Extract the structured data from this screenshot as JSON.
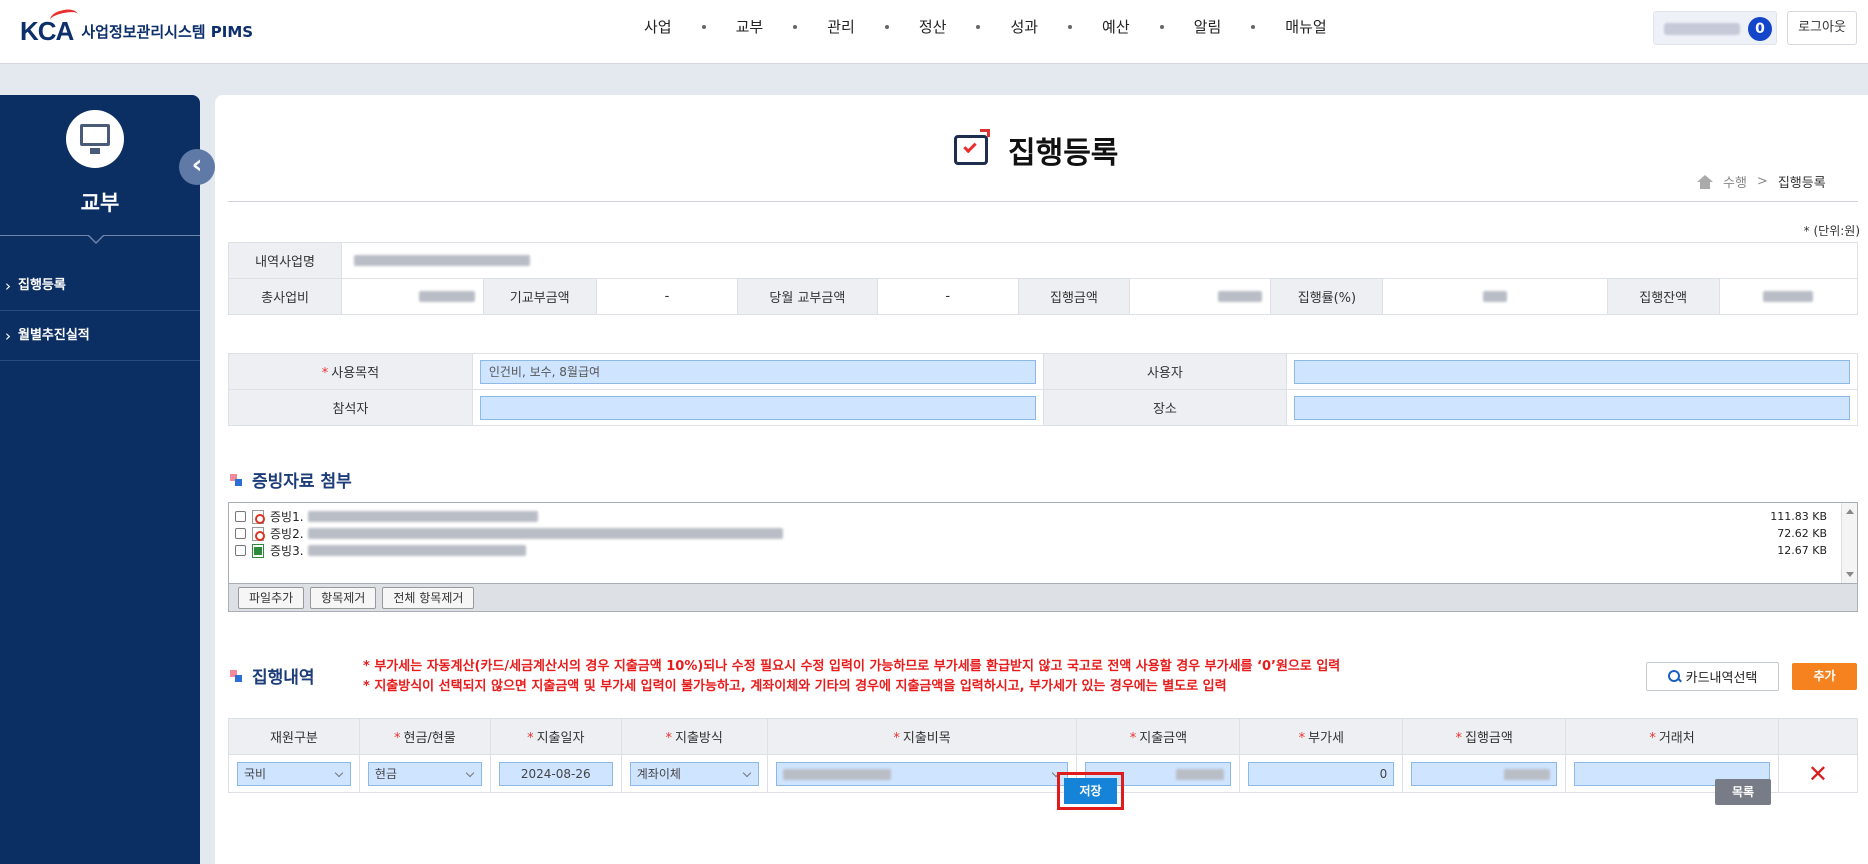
{
  "header": {
    "logo_mark": "KCA",
    "logo_text": "사업정보관리시스템 PIMS",
    "nav": [
      "사업",
      "교부",
      "관리",
      "정산",
      "성과",
      "예산",
      "알림",
      "매뉴얼"
    ],
    "notification_count": "0",
    "logout_label": "로그아웃"
  },
  "sidebar": {
    "title": "교부",
    "items": [
      {
        "label": "집행등록"
      },
      {
        "label": "월별추진실적"
      }
    ],
    "collapse_glyph": "‹"
  },
  "page": {
    "title": "집행등록",
    "breadcrumb": [
      "수행",
      "집행등록"
    ],
    "breadcrumb_sep": ">",
    "unit_note": "* (단위:원)"
  },
  "summary": {
    "project_label": "내역사업명",
    "total_budget_label": "총사업비",
    "prev_grant_label": "기교부금액",
    "prev_grant_value": "-",
    "month_grant_label": "당월 교부금액",
    "month_grant_value": "-",
    "exec_amount_label": "집행금액",
    "exec_rate_label": "집행률(%)",
    "exec_balance_label": "집행잔액"
  },
  "purpose_form": {
    "purpose_label": "사용목적",
    "purpose_value": "인건비, 보수, 8월급여",
    "user_label": "사용자",
    "user_value": "",
    "attendee_label": "참석자",
    "attendee_value": "",
    "place_label": "장소",
    "place_value": ""
  },
  "attachments": {
    "title": "증빙자료 첨부",
    "files": [
      {
        "name": "증빙1.",
        "type": "pdf",
        "size": "111.83 KB"
      },
      {
        "name": "증빙2.",
        "type": "pdf",
        "size": "72.62 KB"
      },
      {
        "name": "증빙3.",
        "type": "xls",
        "size": "12.67 KB"
      }
    ],
    "add_file_label": "파일추가",
    "remove_item_label": "항목제거",
    "remove_all_label": "전체 항목제거"
  },
  "execution": {
    "title": "집행내역",
    "note1": "* 부가세는 자동계산(카드/세금계산서의 경우 지출금액 10%)되나 수정 필요시 수정 입력이 가능하므로 부가세를 환급받지 않고 국고로 전액 사용할 경우 부가세를 ‘0’원으로 입력",
    "note2": "* 지출방식이 선택되지 않으면 지출금액 및 부가세 입력이 불가능하고, 계좌이체와 기타의 경우에 지출금액을 입력하시고, 부가세가 있는 경우에는 별도로 입력",
    "card_button_label": "카드내역선택",
    "add_button_label": "추가",
    "columns": [
      {
        "label": "재원구분",
        "required": false
      },
      {
        "label": "현금/현물",
        "required": true
      },
      {
        "label": "지출일자",
        "required": true
      },
      {
        "label": "지출방식",
        "required": true
      },
      {
        "label": "지출비목",
        "required": true
      },
      {
        "label": "지출금액",
        "required": true
      },
      {
        "label": "부가세",
        "required": true
      },
      {
        "label": "집행금액",
        "required": true
      },
      {
        "label": "거래처",
        "required": true
      }
    ],
    "row": {
      "funding": "국비",
      "cash_type": "현금",
      "date": "2024-08-26",
      "method": "계좌이체",
      "vat": "0",
      "vendor": ""
    },
    "delete_glyph": "✕"
  },
  "actions": {
    "save_label": "저장",
    "list_label": "목록"
  },
  "required_mark": "*",
  "colors": {
    "sidebar_bg": "#0c2f63",
    "accent_blue": "#1583d8",
    "input_bg": "#cfe4ff",
    "orange": "#f5821f",
    "alert_red": "#e81c1c"
  }
}
